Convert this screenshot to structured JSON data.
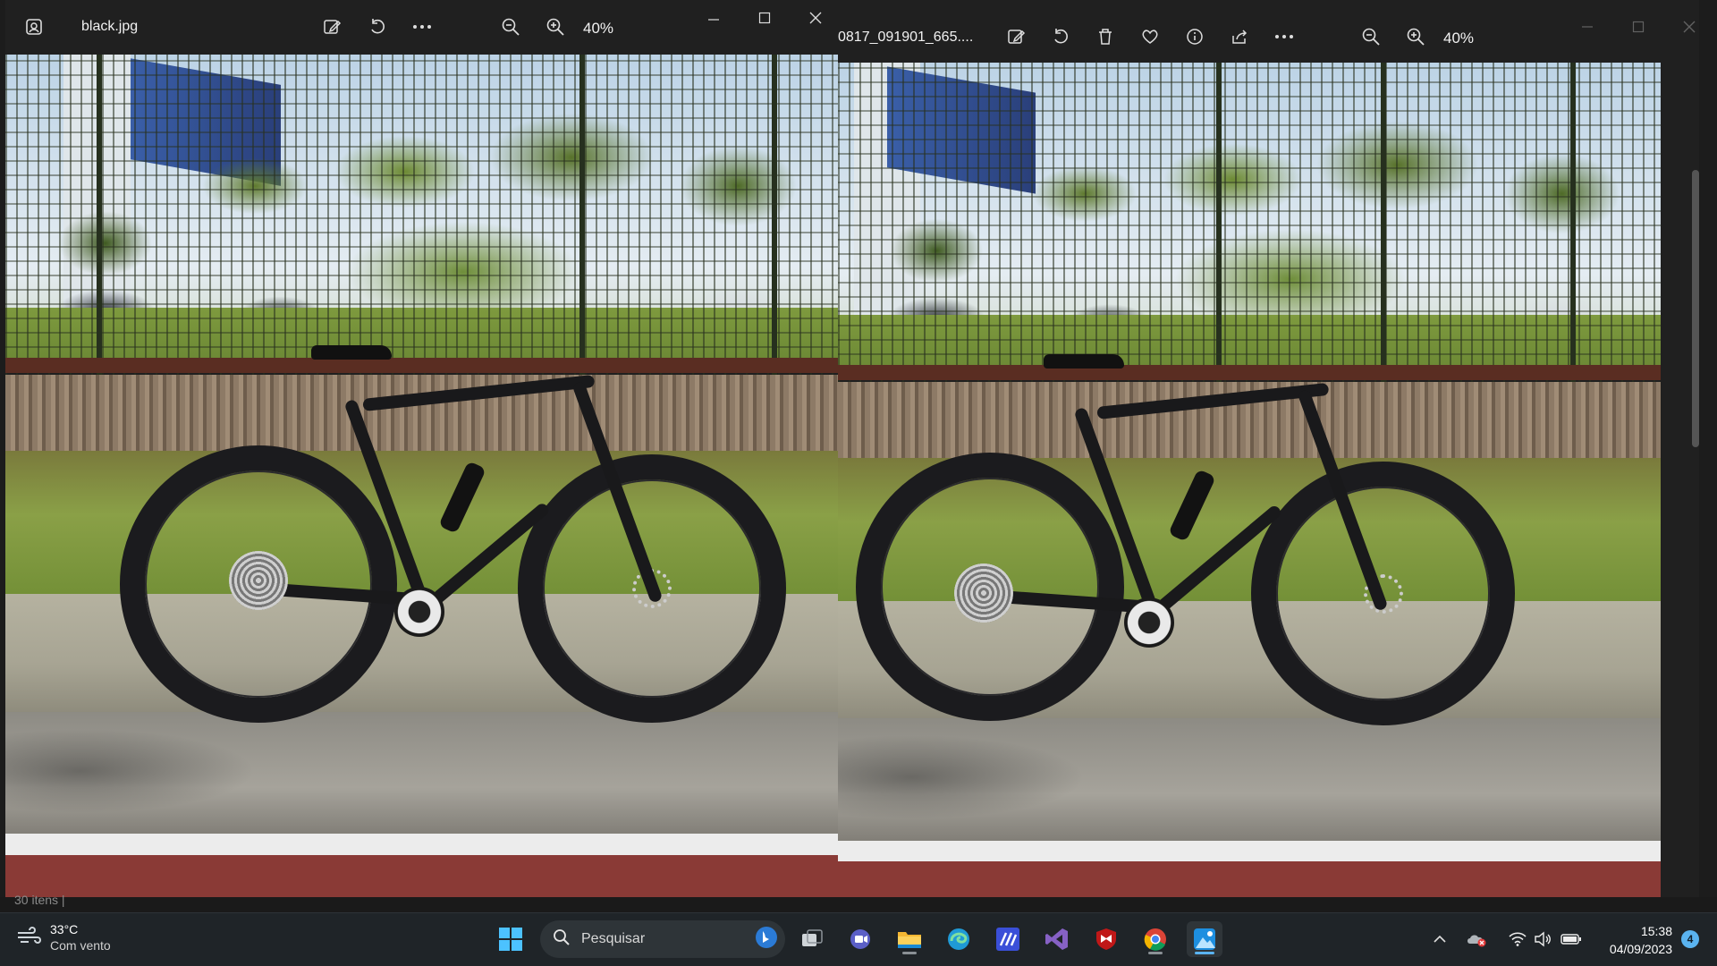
{
  "left_window": {
    "title": "black.jpg",
    "zoom": "40%",
    "toolbar": {
      "app_icon": "photos-app-icon",
      "edit_icon": "edit-image-icon",
      "rotate_icon": "rotate-icon",
      "more_icon": "more-options-icon",
      "zoom_out_icon": "zoom-out-icon",
      "zoom_in_icon": "zoom-in-icon"
    },
    "controls": [
      "minimize-icon",
      "maximize-icon",
      "close-icon"
    ]
  },
  "right_window": {
    "title": "0817_091901_665....",
    "zoom": "40%",
    "toolbar": {
      "edit_icon": "edit-image-icon",
      "rotate_icon": "rotate-icon",
      "delete_icon": "trash-icon",
      "favorite_icon": "heart-icon",
      "info_icon": "info-icon",
      "share_icon": "share-icon",
      "more_icon": "more-options-icon",
      "zoom_out_icon": "zoom-out-icon",
      "zoom_in_icon": "zoom-in-icon"
    }
  },
  "explorer_status": "30 itens  |",
  "taskbar": {
    "weather": {
      "temp": "33°C",
      "condition": "Com vento"
    },
    "search_placeholder": "Pesquisar",
    "apps": [
      "windows-start-icon",
      "task-view-icon",
      "teams-icon",
      "file-explorer-icon",
      "edge-icon",
      "visual-studio-code-icon",
      "visual-studio-icon",
      "mcafee-icon",
      "chrome-icon",
      "photos-icon"
    ],
    "clock": {
      "time": "15:38",
      "date": "04/09/2023"
    },
    "notification_count": "4"
  },
  "colors": {
    "accent": "#5ab3f0",
    "window_bg": "#202020",
    "taskbar_bg": "#1f2428"
  }
}
